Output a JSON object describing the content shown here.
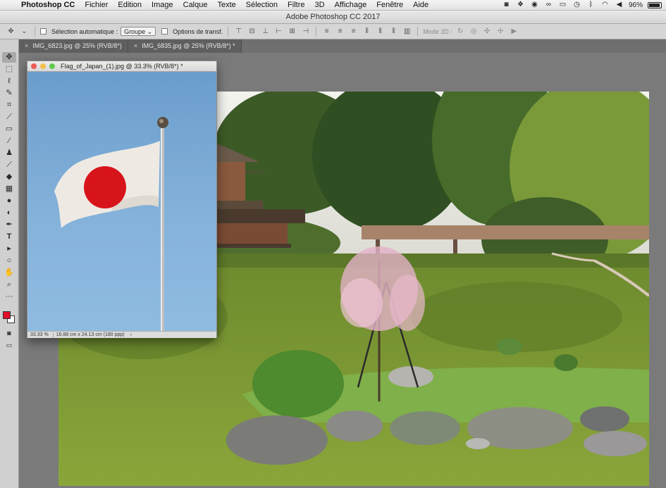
{
  "menubar": {
    "app": "Photoshop CC",
    "items": [
      "Fichier",
      "Edition",
      "Image",
      "Calque",
      "Texte",
      "Sélection",
      "Filtre",
      "3D",
      "Affichage",
      "Fenêtre",
      "Aide"
    ],
    "battery": "96%"
  },
  "titlebar": {
    "title": "Adobe Photoshop CC 2017"
  },
  "options": {
    "auto_select_label": "Sélection automatique :",
    "auto_select_value": "Groupe",
    "transform_label": "Options de transf.",
    "mode3d_label": "Mode 3D :"
  },
  "tabs": [
    {
      "label": "IMG_6823.jpg @ 25% (RVB/8*)"
    },
    {
      "label": "IMG_6835.jpg @ 25% (RVB/8*) *"
    }
  ],
  "flag_window": {
    "title": "Flag_of_Japan_(1).jpg @ 33.3% (RVB/8*) *",
    "zoom": "33.33 %",
    "doc_info": "16.88 cm x 24.13 cm (180 ppp)",
    "arrow": "›"
  },
  "colors": {
    "foreground": "#e0102a",
    "background": "#ffffff"
  },
  "tools": [
    "move-tool-icon",
    "marquee-tool-icon",
    "lasso-tool-icon",
    "quick-select-tool-icon",
    "crop-tool-icon",
    "eyedropper-tool-icon",
    "healing-brush-tool-icon",
    "brush-tool-icon",
    "clone-stamp-tool-icon",
    "history-brush-tool-icon",
    "eraser-tool-icon",
    "gradient-tool-icon",
    "blur-tool-icon",
    "dodge-tool-icon",
    "pen-tool-icon",
    "type-tool-icon",
    "path-select-tool-icon",
    "shape-tool-icon",
    "hand-tool-icon",
    "zoom-tool-icon",
    "more-tools-icon"
  ]
}
